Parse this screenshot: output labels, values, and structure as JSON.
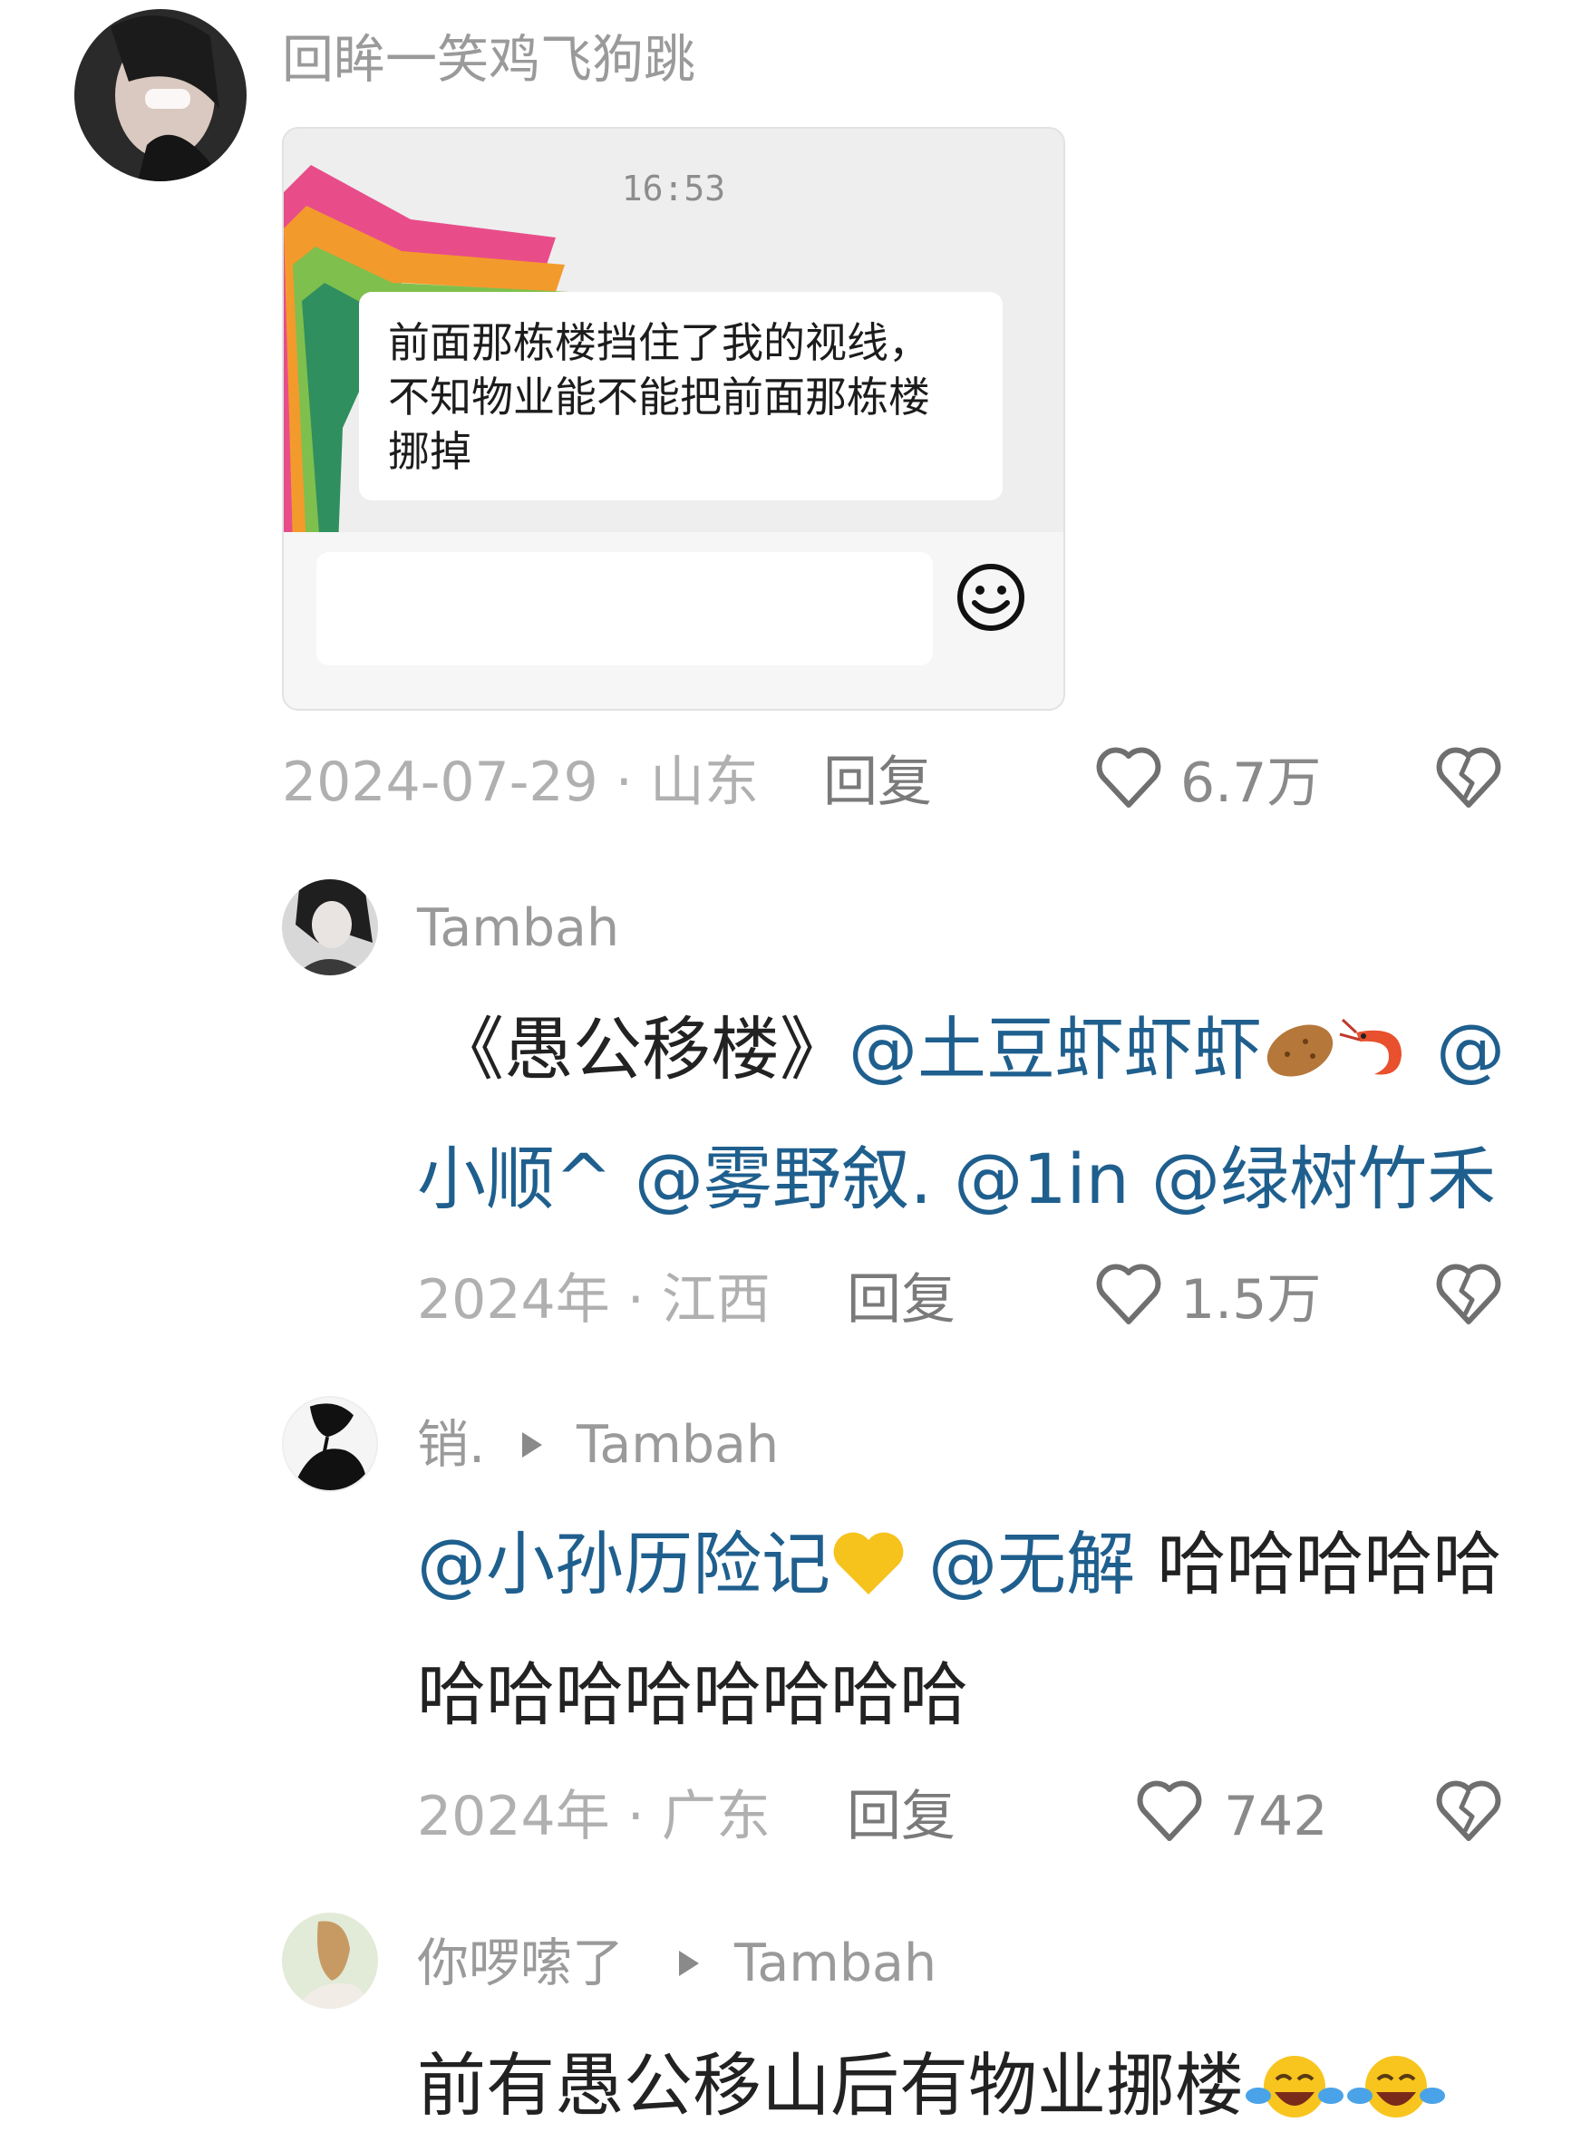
{
  "comments": [
    {
      "username": "回眸一笑鸡飞狗跳",
      "screenshot": {
        "time": "16:53",
        "message_line1": "前面那栋楼挡住了我的视线，",
        "message_line2": "不知物业能不能把前面那栋楼",
        "message_line3": "挪掉"
      },
      "meta": "2024-07-29 · 山东",
      "reply_label": "回复",
      "likes": "6.7万"
    },
    {
      "username": "Tambah",
      "line1_prefix": "《愚公移楼》",
      "line1_mention1": "@土豆虾虾虾",
      "line1_mention2": "@",
      "line2_mention1": "小顺^",
      "line2_mention2": "@雾野叙.",
      "line2_mention3": "@1in",
      "line2_mention4": "@绿树竹禾",
      "meta": "2024年 · 江西",
      "reply_label": "回复",
      "likes": "1.5万"
    },
    {
      "username": "销.",
      "reply_to": "Tambah",
      "line1_mention1": "@小孙历险记",
      "line1_mention2": "@无解",
      "line1_text": "哈哈哈哈哈",
      "line2_text": "哈哈哈哈哈哈哈哈",
      "meta": "2024年 · 广东",
      "reply_label": "回复",
      "likes": "742"
    },
    {
      "username": "你啰嗦了",
      "reply_to": "Tambah",
      "line1_text": "前有愚公移山后有物业挪楼"
    }
  ],
  "icons": {
    "like": "heart-outline-icon",
    "dislike": "broken-heart-icon",
    "reply_arrow": "triangle-right-icon"
  },
  "colors": {
    "mention": "#1f5f8e",
    "meta": "#b0b0b0",
    "username": "#9a9a9a",
    "text": "#222222"
  }
}
